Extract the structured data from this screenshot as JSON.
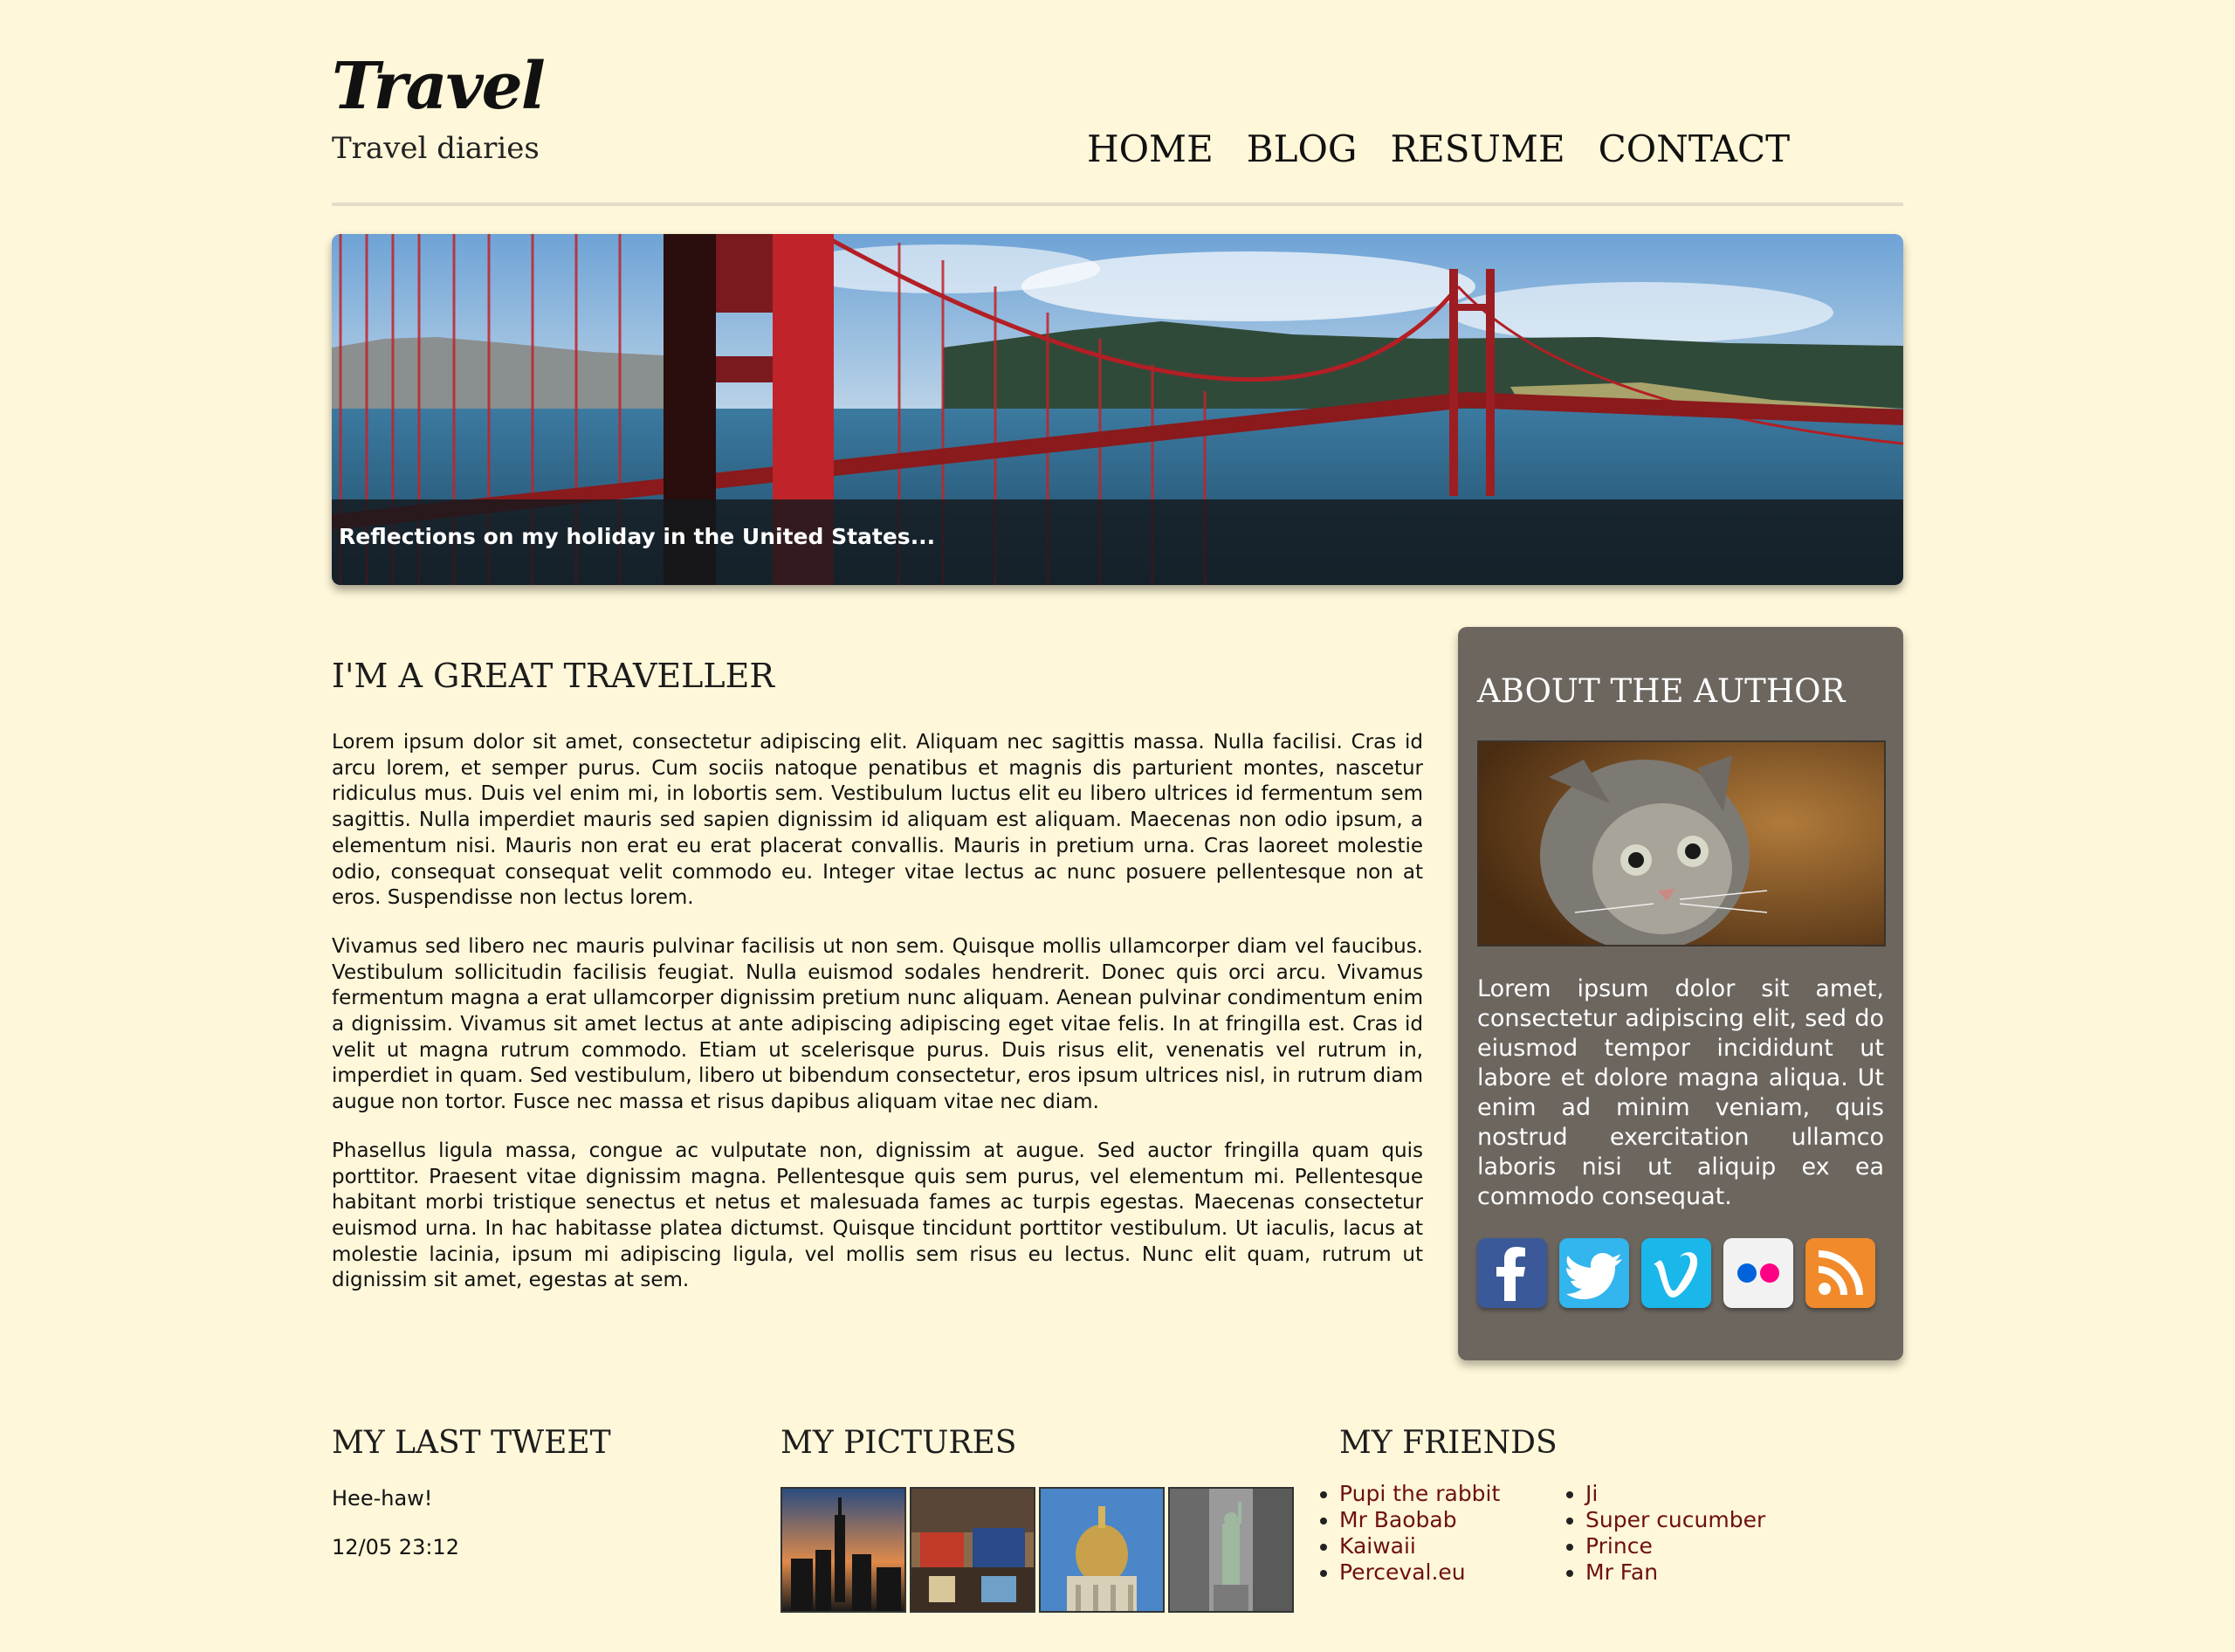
{
  "header": {
    "logo": "Travel",
    "tagline": "Travel diaries",
    "nav": [
      "HOME",
      "BLOG",
      "RESUME",
      "CONTACT"
    ]
  },
  "banner": {
    "caption": "Reflections on my holiday in the United States..."
  },
  "article": {
    "title": "I'M A GREAT TRAVELLER",
    "paragraphs": [
      "Lorem ipsum dolor sit amet, consectetur adipiscing elit. Aliquam nec sagittis massa. Nulla facilisi. Cras id arcu lorem, et semper purus. Cum sociis natoque penatibus et magnis dis parturient montes, nascetur ridiculus mus. Duis vel enim mi, in lobortis sem. Vestibulum luctus elit eu libero ultrices id fermentum sem sagittis. Nulla imperdiet mauris sed sapien dignissim id aliquam est aliquam. Maecenas non odio ipsum, a elementum nisi. Mauris non erat eu erat placerat convallis. Mauris in pretium urna. Cras laoreet molestie odio, consequat consequat velit commodo eu. Integer vitae lectus ac nunc posuere pellentesque non at eros. Suspendisse non lectus lorem.",
      "Vivamus sed libero nec mauris pulvinar facilisis ut non sem. Quisque mollis ullamcorper diam vel faucibus. Vestibulum sollicitudin facilisis feugiat. Nulla euismod sodales hendrerit. Donec quis orci arcu. Vivamus fermentum magna a erat ullamcorper dignissim pretium nunc aliquam. Aenean pulvinar condimentum enim a dignissim. Vivamus sit amet lectus at ante adipiscing adipiscing eget vitae felis. In at fringilla est. Cras id velit ut magna rutrum commodo. Etiam ut scelerisque purus. Duis risus elit, venenatis vel rutrum in, imperdiet in quam. Sed vestibulum, libero ut bibendum consectetur, eros ipsum ultrices nisl, in rutrum diam augue non tortor. Fusce nec massa et risus dapibus aliquam vitae nec diam.",
      "Phasellus ligula massa, congue ac vulputate non, dignissim at augue. Sed auctor fringilla quam quis porttitor. Praesent vitae dignissim magna. Pellentesque quis sem purus, vel elementum mi. Pellentesque habitant morbi tristique senectus et netus et malesuada fames ac turpis egestas. Maecenas consectetur euismod urna. In hac habitasse platea dictumst. Quisque tincidunt porttitor vestibulum. Ut iaculis, lacus at molestie lacinia, ipsum mi adipiscing ligula, vel mollis sem risus eu lectus. Nunc elit quam, rutrum ut dignissim sit amet, egestas at sem."
    ]
  },
  "sidebar": {
    "title": "ABOUT THE AUTHOR",
    "bio": "Lorem ipsum dolor sit amet, consectetur adipiscing elit, sed do eiusmod tempor incididunt ut labore et dolore magna aliqua. Ut enim ad minim veniam, quis nostrud exercitation ullamco laboris nisi ut aliquip ex ea commodo consequat.",
    "social": [
      {
        "icon": "facebook-icon",
        "color": "#3b5998"
      },
      {
        "icon": "twitter-icon",
        "color": "#33b5ee"
      },
      {
        "icon": "vimeo-icon",
        "color": "#1ab7ea"
      },
      {
        "icon": "flickr-icon",
        "color": "#f2f2f2"
      },
      {
        "icon": "rss-icon",
        "color": "#f18a2a"
      }
    ]
  },
  "footer": {
    "tweet": {
      "title": "MY LAST TWEET",
      "text": "Hee-haw!",
      "time": "12/05 23:12"
    },
    "pictures": {
      "title": "MY PICTURES"
    },
    "friends": {
      "title": "MY FRIENDS",
      "col1": [
        "Pupi the rabbit",
        "Mr Baobab",
        "Kaiwaii",
        "Perceval.eu"
      ],
      "col2": [
        "Ji",
        "Super cucumber",
        "Prince",
        "Mr Fan"
      ]
    }
  }
}
